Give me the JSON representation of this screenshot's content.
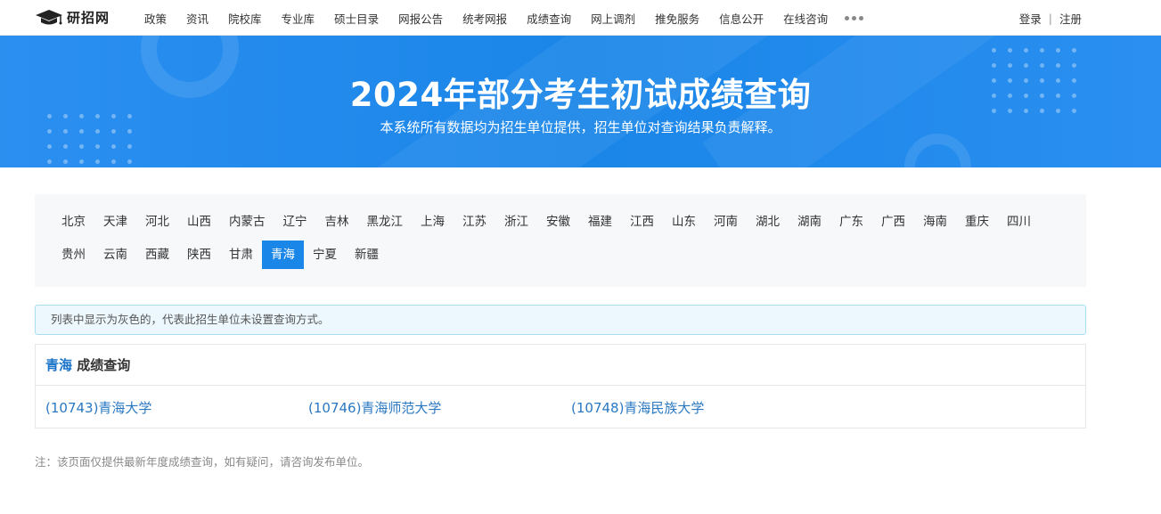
{
  "header": {
    "logo_text": "研招网",
    "nav": [
      "政策",
      "资讯",
      "院校库",
      "专业库",
      "硕士目录",
      "网报公告",
      "统考网报",
      "成绩查询",
      "网上调剂",
      "推免服务",
      "信息公开",
      "在线咨询"
    ],
    "login": "登录",
    "separator": "|",
    "register": "注册"
  },
  "banner": {
    "title": "2024年部分考生初试成绩查询",
    "subtitle": "本系统所有数据均为招生单位提供，招生单位对查询结果负责解释。"
  },
  "regions": {
    "row1": [
      "北京",
      "天津",
      "河北",
      "山西",
      "内蒙古",
      "辽宁",
      "吉林",
      "黑龙江",
      "上海",
      "江苏",
      "浙江",
      "安徽",
      "福建",
      "江西",
      "山东",
      "河南",
      "湖北",
      "湖南",
      "广东",
      "广西",
      "海南",
      "重庆",
      "四川"
    ],
    "row2": [
      "贵州",
      "云南",
      "西藏",
      "陕西",
      "甘肃",
      "青海",
      "宁夏",
      "新疆"
    ],
    "active": "青海"
  },
  "tip": "列表中显示为灰色的，代表此招生单位未设置查询方式。",
  "results": {
    "province": "青海",
    "heading": "成绩查询",
    "schools": [
      "(10743)青海大学",
      "(10746)青海师范大学",
      "(10748)青海民族大学"
    ]
  },
  "note": "注：该页面仅提供最新年度成绩查询，如有疑问，请咨询发布单位。",
  "colors": {
    "accent": "#1a86e8",
    "link": "#2a78c2"
  }
}
